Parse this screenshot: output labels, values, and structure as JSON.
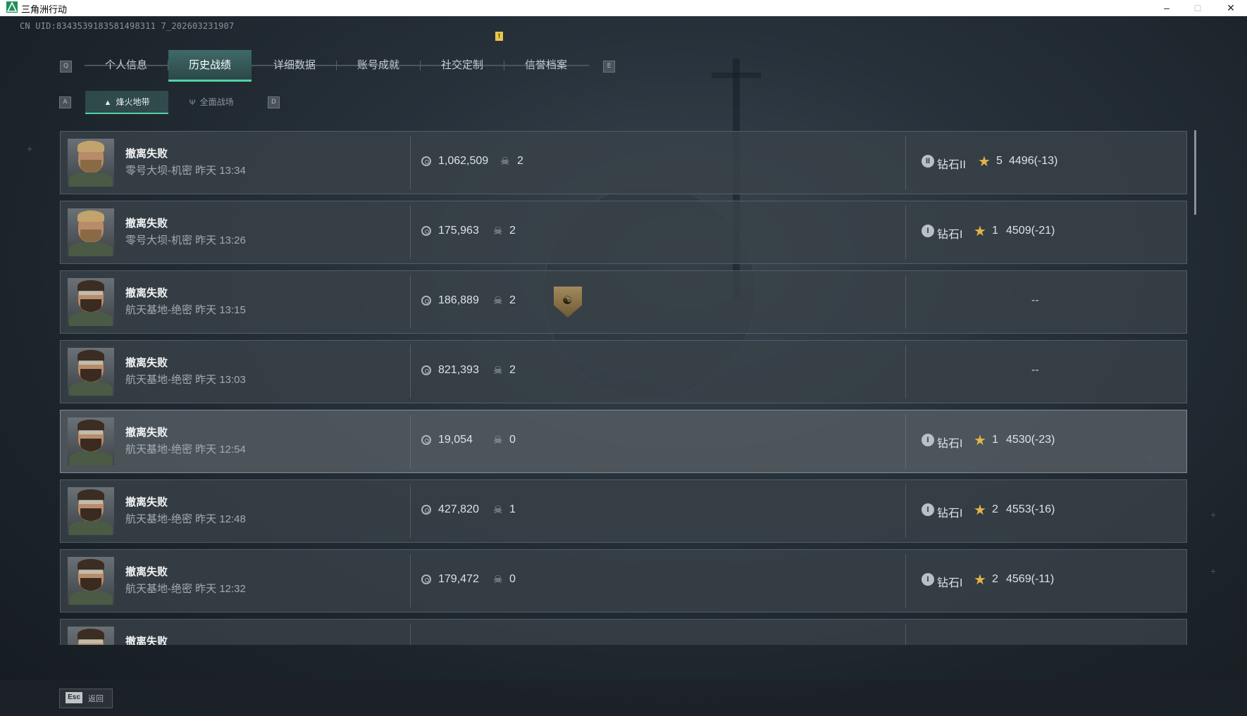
{
  "window": {
    "title": "三角洲行动"
  },
  "uid": "CN UID:8343539183581498311 7_202603231907",
  "key_hints": {
    "tab_prev": "Q",
    "tab_next": "E",
    "sub_prev": "A",
    "sub_next": "D"
  },
  "tabs": [
    {
      "label": "个人信息",
      "active": false
    },
    {
      "label": "历史战绩",
      "active": true
    },
    {
      "label": "详细数据",
      "active": false
    },
    {
      "label": "账号成就",
      "active": false
    },
    {
      "label": "社交定制",
      "active": false
    },
    {
      "label": "信誉档案",
      "active": false
    }
  ],
  "notify_badge": "!",
  "subtabs": [
    {
      "label": "烽火地带",
      "icon": "triangle-mode-icon",
      "active": true
    },
    {
      "label": "全面战场",
      "icon": "battlefield-icon",
      "active": false
    }
  ],
  "rows": [
    {
      "result": "撤离失败",
      "detail": "零号大坝-机密 昨天 13:34",
      "value": "1,062,509",
      "kills": "2",
      "rank_icon": "II",
      "rank": "钻石II",
      "stars": "5",
      "score": "4496(-13)",
      "avatar": "blond",
      "emblem": false
    },
    {
      "result": "撤离失败",
      "detail": "零号大坝-机密 昨天 13:26",
      "value": "175,963",
      "kills": "2",
      "rank_icon": "I",
      "rank": "钻石I",
      "stars": "1",
      "score": "4509(-21)",
      "avatar": "blond",
      "emblem": false
    },
    {
      "result": "撤离失败",
      "detail": "航天基地-绝密 昨天 13:15",
      "value": "186,889",
      "kills": "2",
      "rank": "--",
      "avatar": "dark",
      "emblem": true
    },
    {
      "result": "撤离失败",
      "detail": "航天基地-绝密 昨天 13:03",
      "value": "821,393",
      "kills": "2",
      "rank": "--",
      "avatar": "dark",
      "emblem": false
    },
    {
      "result": "撤离失败",
      "detail": "航天基地-绝密 昨天 12:54",
      "value": "19,054",
      "kills": "0",
      "rank_icon": "I",
      "rank": "钻石I",
      "stars": "1",
      "score": "4530(-23)",
      "avatar": "dark",
      "emblem": false,
      "highlighted": true
    },
    {
      "result": "撤离失败",
      "detail": "航天基地-绝密 昨天 12:48",
      "value": "427,820",
      "kills": "1",
      "rank_icon": "I",
      "rank": "钻石I",
      "stars": "2",
      "score": "4553(-16)",
      "avatar": "dark",
      "emblem": false
    },
    {
      "result": "撤离失败",
      "detail": "航天基地-绝密 昨天 12:32",
      "value": "179,472",
      "kills": "0",
      "rank_icon": "I",
      "rank": "钻石I",
      "stars": "2",
      "score": "4569(-11)",
      "avatar": "dark",
      "emblem": false
    },
    {
      "result": "撤离失败",
      "detail": "",
      "value": "",
      "kills": "",
      "rank": "",
      "avatar": "dark",
      "emblem": false
    }
  ],
  "footer": {
    "esc_key": "Esc",
    "esc_label": "返回"
  }
}
